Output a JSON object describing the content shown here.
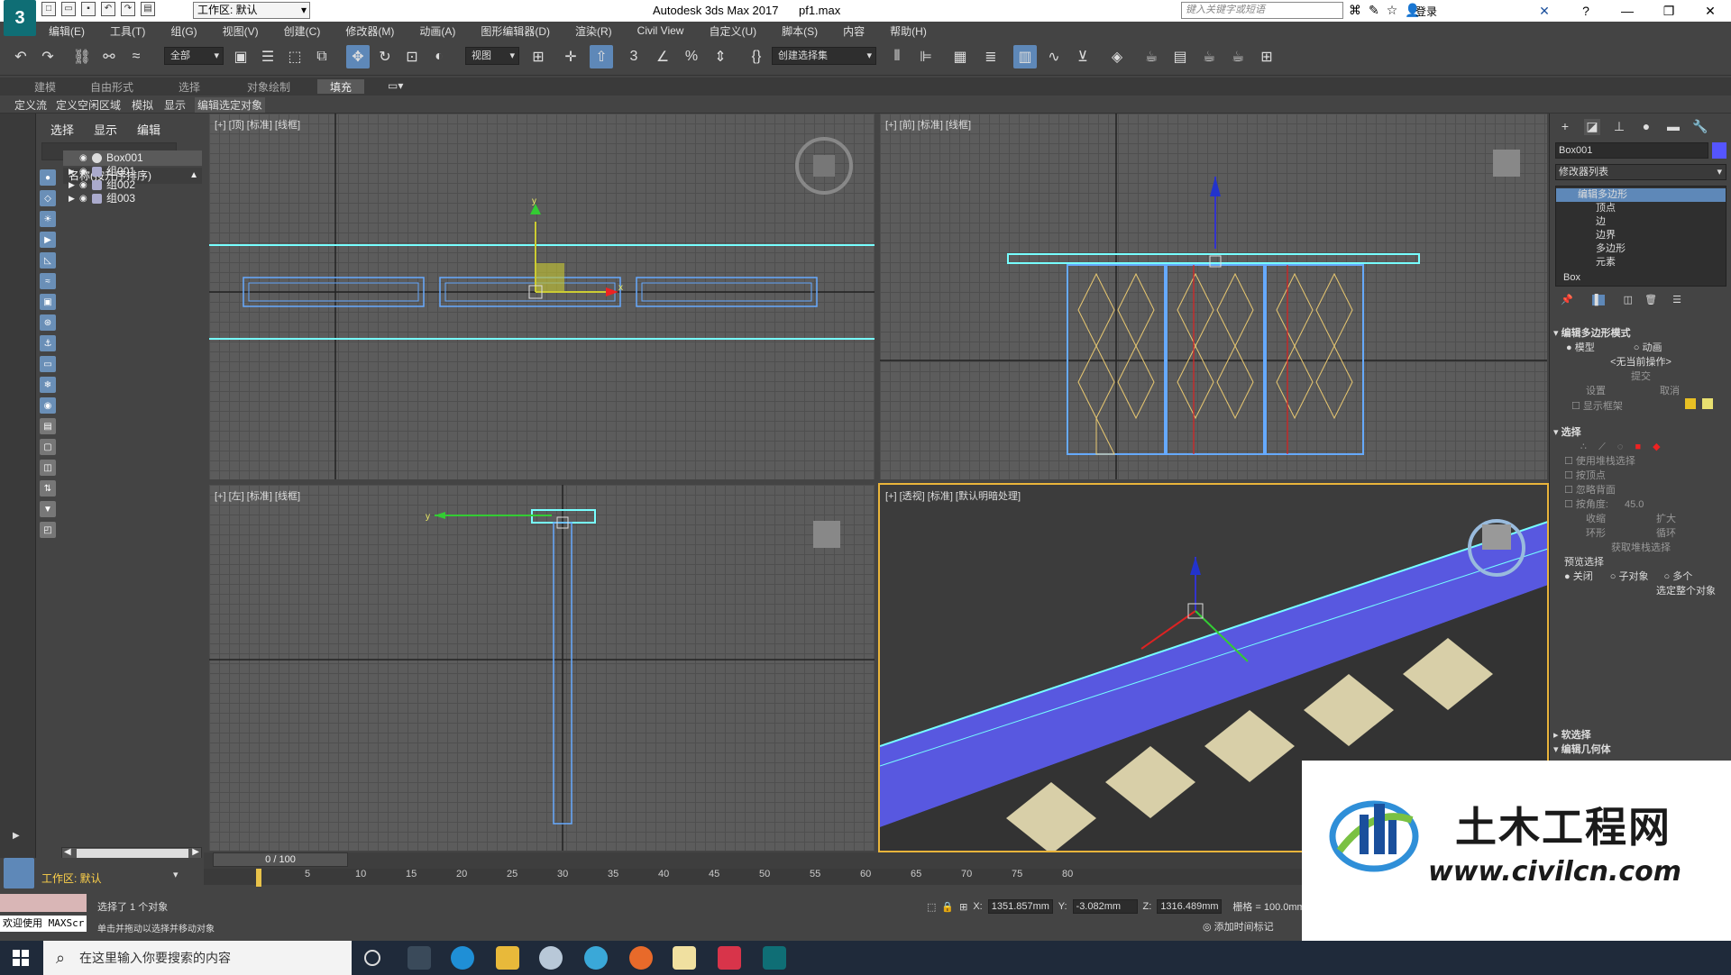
{
  "app": {
    "logo_text": "3",
    "title": "Autodesk 3ds Max 2017",
    "document": "pf1.max",
    "workspace": "工作区: 默认",
    "search_placeholder": "键入关键字或短语",
    "login": "登录"
  },
  "menu": [
    "编辑(E)",
    "工具(T)",
    "组(G)",
    "视图(V)",
    "创建(C)",
    "修改器(M)",
    "动画(A)",
    "图形编辑器(D)",
    "渲染(R)",
    "Civil View",
    "自定义(U)",
    "脚本(S)",
    "内容",
    "帮助(H)"
  ],
  "toolbar": {
    "selection_filter": "全部",
    "ref_coord": "视图",
    "named_selection": "创建选择集"
  },
  "ribbon": {
    "tabs": [
      "建模",
      "自由形式",
      "选择",
      "对象绘制",
      "填充"
    ],
    "active_tab": "填充",
    "sub_items": [
      "定义流",
      "定义空闲区域",
      "模拟",
      "显示",
      "编辑选定对象"
    ]
  },
  "explorer": {
    "tabs": [
      "选择",
      "显示",
      "编辑"
    ],
    "column_header": "名称(按升序排序)",
    "rows": [
      {
        "name": "Box001",
        "selected": true
      },
      {
        "name": "组001",
        "selected": false
      },
      {
        "name": "组002",
        "selected": false
      },
      {
        "name": "组003",
        "selected": false
      }
    ]
  },
  "viewports": {
    "top": "[+] [顶] [标准] [线框]",
    "front": "[+] [前] [标准] [线框]",
    "left": "[+] [左] [标准] [线框]",
    "perspective": "[+] [透视] [标准] [默认明暗处理]"
  },
  "command_panel": {
    "object_name": "Box001",
    "object_color": "#5555ff",
    "modifier_list": "修改器列表",
    "stack": [
      "编辑多边形",
      "顶点",
      "边",
      "边界",
      "多边形",
      "元素",
      "Box"
    ],
    "rollout_edit_poly": "编辑多边形模式",
    "mode_model": "模型",
    "mode_anim": "动画",
    "no_op": "<无当前操作>",
    "commit": "提交",
    "settings": "设置",
    "cancel": "取消",
    "show_cage": "显示框架",
    "rollout_select": "选择",
    "by_vertex": "使用堆栈选择",
    "by_vertex2": "按顶点",
    "ignore_back": "忽略背面",
    "by_angle": "按角度:",
    "angle_value": "45.0",
    "shrink": "收缩",
    "grow": "扩大",
    "ring": "环形",
    "loop": "循环",
    "get_stack": "获取堆栈选择",
    "preview": "预览选择",
    "off": "关闭",
    "subobj": "子对象",
    "multi": "多个",
    "select_whole": "选定整个对象",
    "soft_sel": "软选择",
    "edit_geom": "编辑几何体"
  },
  "timeline": {
    "frame_display": "0 / 100",
    "ticks": [
      "5",
      "10",
      "15",
      "20",
      "25",
      "30",
      "35",
      "40",
      "45",
      "50",
      "55",
      "60",
      "65",
      "70",
      "75",
      "80"
    ]
  },
  "status": {
    "selected": "选择了 1 个对象",
    "hint": "单击并拖动以选择并移动对象",
    "maxscript": "欢迎使用 MAXScr",
    "x_label": "X:",
    "x": "1351.857mm",
    "y_label": "Y:",
    "y": "-3.082mm",
    "z_label": "Z:",
    "z": "1316.489mm",
    "grid": "栅格 = 100.0mm",
    "add_tag": "添加时间标记"
  },
  "taskbar": {
    "search_placeholder": "在这里输入你要搜索的内容"
  },
  "watermark": {
    "title": "土木工程网",
    "url": "www.civilcn.com"
  }
}
